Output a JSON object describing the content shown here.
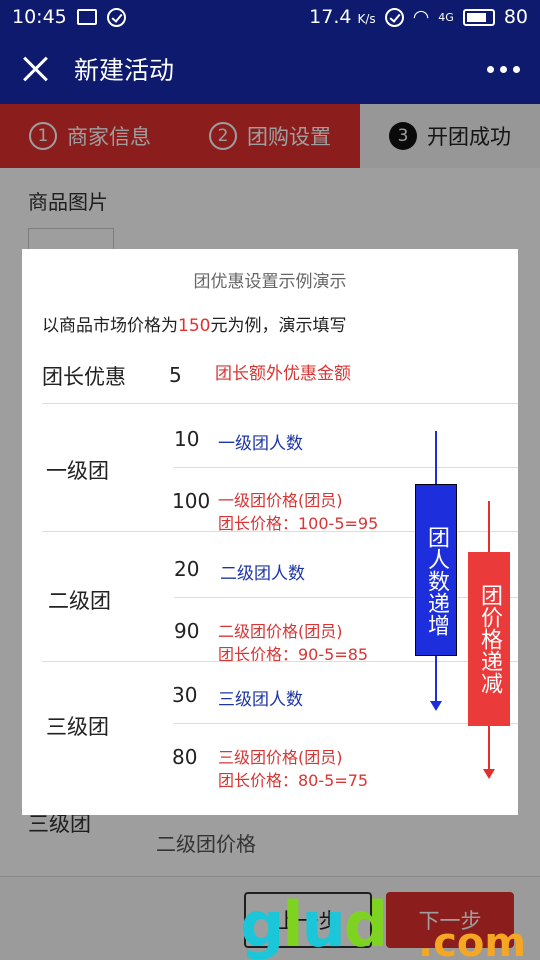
{
  "statusbar": {
    "time": "10:45",
    "speed": "17.4",
    "speed_unit": "K/s",
    "network": "4G",
    "battery": "80",
    "battery_level": 0.8
  },
  "header": {
    "title": "新建活动"
  },
  "steps": [
    {
      "num": "1",
      "label": "商家信息"
    },
    {
      "num": "2",
      "label": "团购设置"
    },
    {
      "num": "3",
      "label": "开团成功"
    }
  ],
  "form": {
    "image_label": "商品图片",
    "tier3_label": "三级团",
    "tier2_price_label": "二级团价格",
    "prev_button": "上一步",
    "next_button": "下一步"
  },
  "modal": {
    "title": "团优惠设置示例演示",
    "intro_pre": "以商品市场价格为",
    "intro_price": "150",
    "intro_post": "元为例，演示填写",
    "leader": {
      "label": "团长优惠",
      "value": "5",
      "desc": "团长额外优惠金额"
    },
    "tiers": [
      {
        "label": "一级团",
        "count": "10",
        "count_desc": "一级团人数",
        "price": "100",
        "price_desc": "一级团价格(团员)",
        "leader_price": "团长价格：100-5=95"
      },
      {
        "label": "二级团",
        "count": "20",
        "count_desc": "二级团人数",
        "price": "90",
        "price_desc": "二级团价格(团员)",
        "leader_price": "团长价格：90-5=85"
      },
      {
        "label": "三级团",
        "count": "30",
        "count_desc": "三级团人数",
        "price": "80",
        "price_desc": "三级团价格(团员)",
        "leader_price": "团长价格：80-5=75"
      }
    ],
    "blue_bar": "团人数递增",
    "red_bar": "团价格递减"
  },
  "watermark": {
    "text": "glud",
    "suffix": ".com"
  },
  "colors": {
    "navbar": "#0d1a6e",
    "accent_red": "#e23030",
    "blue": "#1d35a8"
  }
}
